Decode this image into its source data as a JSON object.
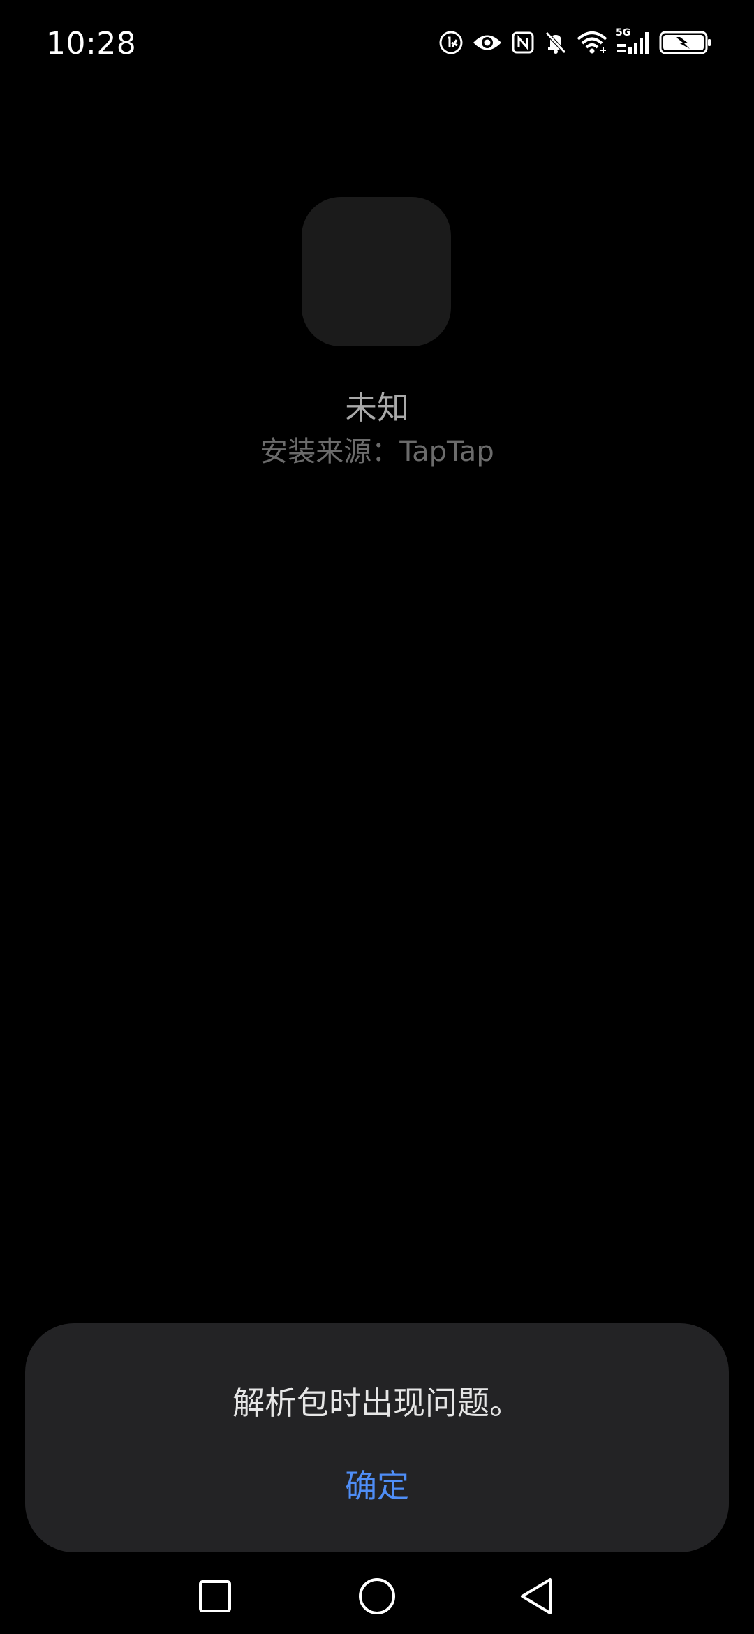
{
  "status_bar": {
    "time": "10:28",
    "icons": [
      "accessibility-badge-icon",
      "eye-protection-icon",
      "nfc-icon",
      "silent-bell-icon",
      "wifi-icon",
      "5g-signal-icon",
      "battery-charging-icon"
    ],
    "network_label": "5G"
  },
  "app": {
    "name": "未知",
    "install_source": "安装来源：TapTap"
  },
  "dialog": {
    "message": "解析包时出现问题。",
    "ok_label": "确定"
  },
  "navigation": {
    "icons": [
      "recents-square-icon",
      "home-circle-icon",
      "back-triangle-icon"
    ]
  },
  "colors": {
    "background": "#000000",
    "dialog_background": "#232325",
    "accent": "#4f8ef7",
    "placeholder_icon": "#1b1b1b"
  }
}
